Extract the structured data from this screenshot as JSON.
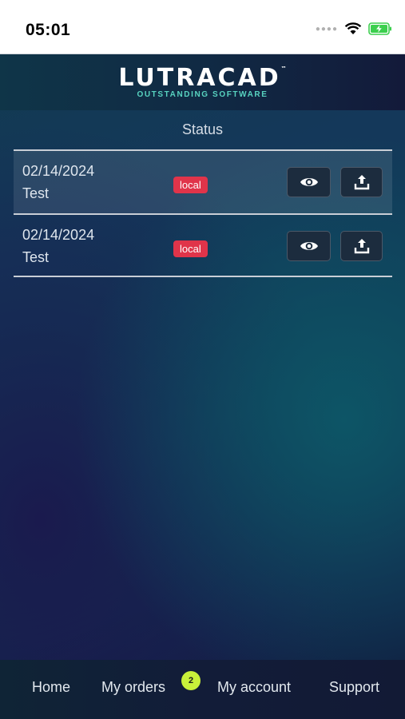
{
  "status_bar": {
    "time": "05:01",
    "signal_icon": "signal-dots-icon",
    "wifi_icon": "wifi-icon",
    "battery_icon": "battery-charging-icon"
  },
  "header": {
    "logo_text": "LUTRACAD",
    "logo_tm": "™",
    "tagline": "OUTSTANDING SOFTWARE"
  },
  "list": {
    "column_header": "Status",
    "rows": [
      {
        "date": "02/14/2024",
        "name": "Test",
        "status": "local",
        "view_icon": "eye-icon",
        "upload_icon": "upload-icon"
      },
      {
        "date": "02/14/2024",
        "name": "Test",
        "status": "local",
        "view_icon": "eye-icon",
        "upload_icon": "upload-icon"
      }
    ]
  },
  "tabbar": {
    "home": "Home",
    "orders": "My orders",
    "orders_badge": "2",
    "account": "My account",
    "support": "Support"
  },
  "colors": {
    "badge_local": "#e0344a",
    "orders_badge": "#c8f03a",
    "tagline": "#58d3c0",
    "battery": "#3ccf4e"
  }
}
